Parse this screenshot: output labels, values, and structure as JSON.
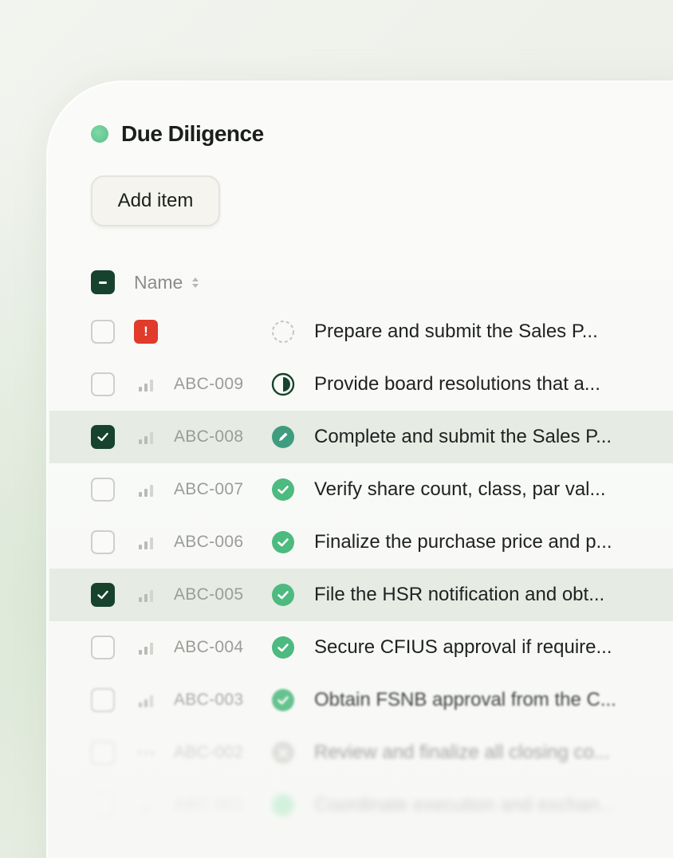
{
  "project": {
    "title": "Due Diligence",
    "status_color": "#5cc08b"
  },
  "toolbar": {
    "add_label": "Add item"
  },
  "table": {
    "header": {
      "name_label": "Name",
      "select_all_state": "indeterminate"
    },
    "rows": [
      {
        "checked": false,
        "priority": "urgent",
        "priority_glyph": "!",
        "id": "",
        "status": "todo",
        "task": "Prepare and submit the Sales P..."
      },
      {
        "checked": false,
        "priority": "medium",
        "id": "ABC-009",
        "status": "in-progress",
        "task": "Provide board resolutions that a..."
      },
      {
        "checked": true,
        "priority": "medium",
        "id": "ABC-008",
        "status": "in-review",
        "task": "Complete and submit the Sales P..."
      },
      {
        "checked": false,
        "priority": "medium",
        "id": "ABC-007",
        "status": "done",
        "task": "Verify share count, class, par val..."
      },
      {
        "checked": false,
        "priority": "medium",
        "id": "ABC-006",
        "status": "done",
        "task": "Finalize the purchase price and p..."
      },
      {
        "checked": true,
        "priority": "medium",
        "id": "ABC-005",
        "status": "done",
        "task": "File the HSR notification and obt..."
      },
      {
        "checked": false,
        "priority": "medium",
        "id": "ABC-004",
        "status": "done",
        "task": "Secure CFIUS approval if require..."
      },
      {
        "checked": false,
        "priority": "medium",
        "id": "ABC-003",
        "status": "done",
        "task": "Obtain FSNB approval from the C..."
      },
      {
        "checked": false,
        "priority": "none",
        "id": "ABC-002",
        "status": "canceled",
        "task": "Review and finalize all closing co..."
      },
      {
        "checked": false,
        "priority": "low",
        "id": "ABC-001",
        "status": "done-green",
        "task": "Coordinate execution and exchan..."
      }
    ]
  },
  "colors": {
    "accent_dark": "#17432c",
    "done_green": "#4dba7f",
    "in_progress": "#17432c",
    "in_review": "#3f9c7f",
    "urgent_red": "#e03b2b",
    "selected_row": "#e6ebe4"
  }
}
